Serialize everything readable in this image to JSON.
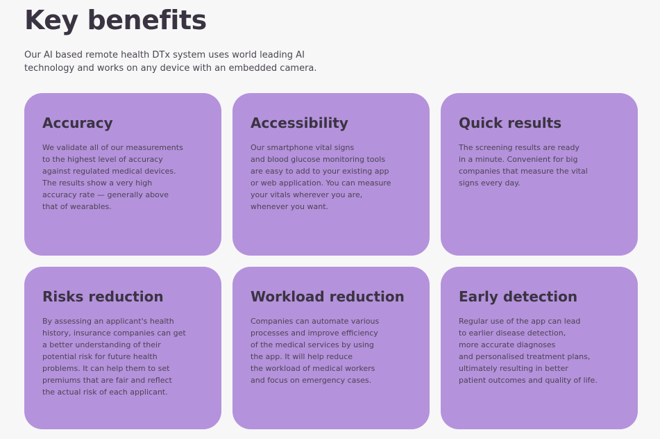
{
  "header": {
    "title": "Key benefits",
    "intro_lines": [
      "Our AI based remote health DTx system uses world leading AI",
      "technology and works on any device with an embedded camera."
    ]
  },
  "colors": {
    "card_background": "#b592dc",
    "page_background": "#f7f7f8",
    "heading_text": "#3a3442"
  },
  "cards": [
    {
      "title": "Accuracy",
      "lines": [
        "We validate all of our measurements",
        "to the highest level of accuracy",
        "against regulated medical devices.",
        "The results show a very high",
        "accuracy rate — generally above",
        "that of wearables."
      ]
    },
    {
      "title": "Accessibility",
      "lines": [
        "Our smartphone vital signs",
        "and blood glucose monitoring tools",
        "are easy to add to your existing app",
        "or web application. You can measure",
        "your vitals wherever you are,",
        "whenever you want."
      ]
    },
    {
      "title": "Quick results",
      "lines": [
        "The screening results are ready",
        "in a minute. Convenient for big",
        "companies that measure the vital",
        "signs every day."
      ]
    },
    {
      "title": "Risks reduction",
      "lines": [
        "By assessing an applicant's health",
        "history, insurance companies can get",
        "a better understanding of their",
        "potential risk for future health",
        "problems. It can help them to set",
        "premiums that are fair and reflect",
        "the actual risk of each applicant."
      ]
    },
    {
      "title": "Workload reduction",
      "lines": [
        "Companies can automate various",
        "processes and improve efficiency",
        "of the medical services by using",
        "the app. It will help reduce",
        "the workload of medical workers",
        "and focus on emergency cases."
      ]
    },
    {
      "title": "Early detection",
      "lines": [
        "Regular use of the app can lead",
        "to earlier disease detection,",
        "more accurate diagnoses",
        "and personalised treatment plans,",
        "ultimately resulting in better",
        "patient outcomes and quality of life."
      ]
    }
  ]
}
